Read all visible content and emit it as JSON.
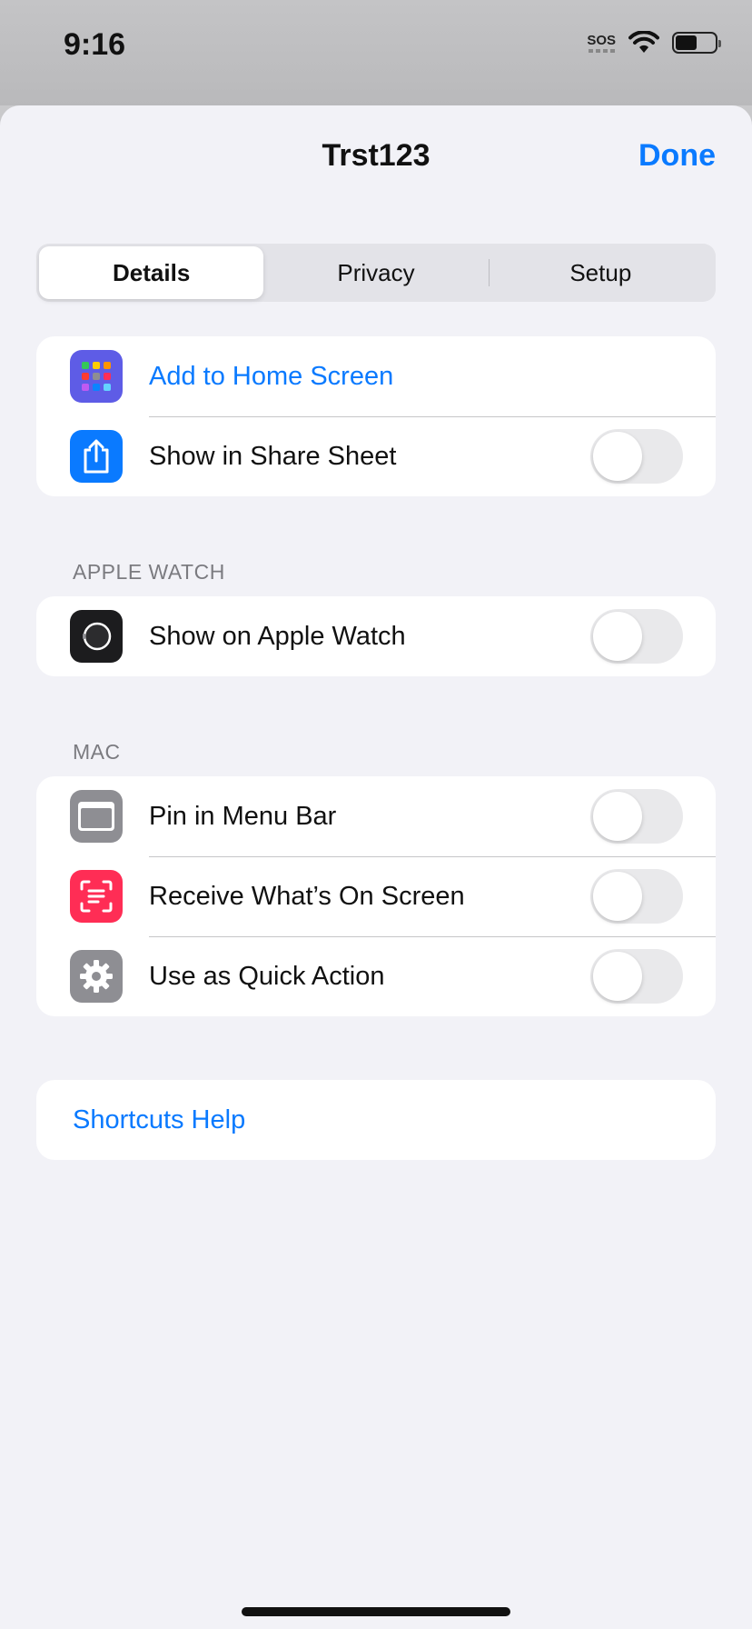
{
  "status_bar": {
    "time": "9:16",
    "sos": "SOS"
  },
  "header": {
    "title": "Trst123",
    "done_label": "Done"
  },
  "tabs": [
    {
      "label": "Details",
      "active": true
    },
    {
      "label": "Privacy",
      "active": false
    },
    {
      "label": "Setup",
      "active": false
    }
  ],
  "general": {
    "add_home": {
      "label": "Add to Home Screen",
      "icon": "home-screen-grid-icon",
      "color": "#5e5ce6"
    },
    "share_sheet": {
      "label": "Show in Share Sheet",
      "icon": "share-icon",
      "color": "#0a7aff",
      "on": false
    }
  },
  "apple_watch": {
    "header": "APPLE WATCH",
    "show_watch": {
      "label": "Show on Apple Watch",
      "icon": "apple-watch-icon",
      "on": false
    }
  },
  "mac": {
    "header": "MAC",
    "pin_menu": {
      "label": "Pin in Menu Bar",
      "icon": "menu-bar-icon",
      "on": false
    },
    "receive_screen": {
      "label": "Receive What’s On Screen",
      "icon": "screen-scan-icon",
      "color": "#ff2d55",
      "on": false
    },
    "quick_action": {
      "label": "Use as Quick Action",
      "icon": "gear-icon",
      "on": false
    }
  },
  "help": {
    "label": "Shortcuts Help"
  }
}
